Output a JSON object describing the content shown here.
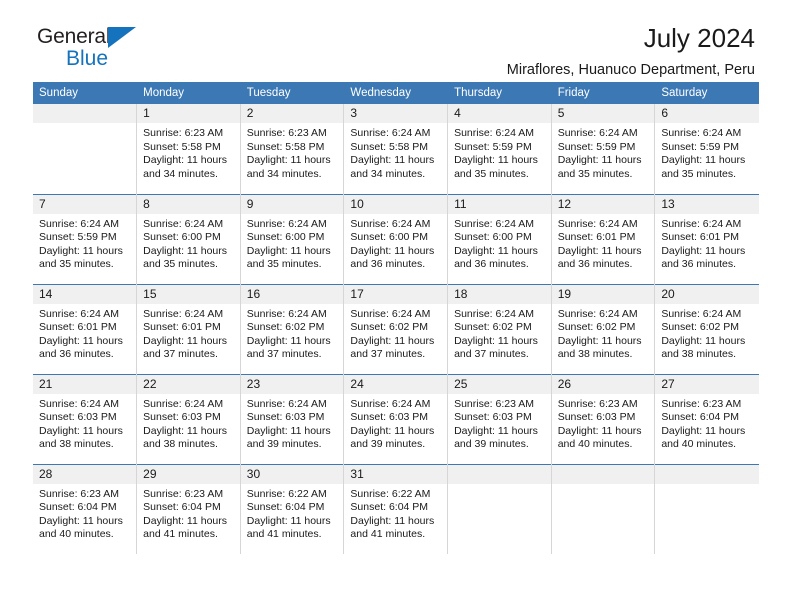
{
  "brand": {
    "name_top": "General",
    "name_bottom": "Blue",
    "triangle_icon": "triangle-icon",
    "color_dark": "#231f20",
    "color_blue": "#1573bd"
  },
  "header": {
    "title": "July 2024",
    "subtitle": "Miraflores, Huanuco Department, Peru"
  },
  "theme": {
    "header_row_bg": "#3c78b4",
    "daynum_bg": "#f0f0f0",
    "text": "#1a1a1a"
  },
  "weekday_headers": [
    "Sunday",
    "Monday",
    "Tuesday",
    "Wednesday",
    "Thursday",
    "Friday",
    "Saturday"
  ],
  "labels": {
    "sunrise_prefix": "Sunrise:",
    "sunset_prefix": "Sunset:",
    "daylight_prefix": "Daylight:"
  },
  "weeks": [
    [
      {
        "day": "",
        "sunrise": "",
        "sunset": "",
        "daylight": ""
      },
      {
        "day": "1",
        "sunrise": "Sunrise: 6:23 AM",
        "sunset": "Sunset: 5:58 PM",
        "daylight": "Daylight: 11 hours and 34 minutes."
      },
      {
        "day": "2",
        "sunrise": "Sunrise: 6:23 AM",
        "sunset": "Sunset: 5:58 PM",
        "daylight": "Daylight: 11 hours and 34 minutes."
      },
      {
        "day": "3",
        "sunrise": "Sunrise: 6:24 AM",
        "sunset": "Sunset: 5:58 PM",
        "daylight": "Daylight: 11 hours and 34 minutes."
      },
      {
        "day": "4",
        "sunrise": "Sunrise: 6:24 AM",
        "sunset": "Sunset: 5:59 PM",
        "daylight": "Daylight: 11 hours and 35 minutes."
      },
      {
        "day": "5",
        "sunrise": "Sunrise: 6:24 AM",
        "sunset": "Sunset: 5:59 PM",
        "daylight": "Daylight: 11 hours and 35 minutes."
      },
      {
        "day": "6",
        "sunrise": "Sunrise: 6:24 AM",
        "sunset": "Sunset: 5:59 PM",
        "daylight": "Daylight: 11 hours and 35 minutes."
      }
    ],
    [
      {
        "day": "7",
        "sunrise": "Sunrise: 6:24 AM",
        "sunset": "Sunset: 5:59 PM",
        "daylight": "Daylight: 11 hours and 35 minutes."
      },
      {
        "day": "8",
        "sunrise": "Sunrise: 6:24 AM",
        "sunset": "Sunset: 6:00 PM",
        "daylight": "Daylight: 11 hours and 35 minutes."
      },
      {
        "day": "9",
        "sunrise": "Sunrise: 6:24 AM",
        "sunset": "Sunset: 6:00 PM",
        "daylight": "Daylight: 11 hours and 35 minutes."
      },
      {
        "day": "10",
        "sunrise": "Sunrise: 6:24 AM",
        "sunset": "Sunset: 6:00 PM",
        "daylight": "Daylight: 11 hours and 36 minutes."
      },
      {
        "day": "11",
        "sunrise": "Sunrise: 6:24 AM",
        "sunset": "Sunset: 6:00 PM",
        "daylight": "Daylight: 11 hours and 36 minutes."
      },
      {
        "day": "12",
        "sunrise": "Sunrise: 6:24 AM",
        "sunset": "Sunset: 6:01 PM",
        "daylight": "Daylight: 11 hours and 36 minutes."
      },
      {
        "day": "13",
        "sunrise": "Sunrise: 6:24 AM",
        "sunset": "Sunset: 6:01 PM",
        "daylight": "Daylight: 11 hours and 36 minutes."
      }
    ],
    [
      {
        "day": "14",
        "sunrise": "Sunrise: 6:24 AM",
        "sunset": "Sunset: 6:01 PM",
        "daylight": "Daylight: 11 hours and 36 minutes."
      },
      {
        "day": "15",
        "sunrise": "Sunrise: 6:24 AM",
        "sunset": "Sunset: 6:01 PM",
        "daylight": "Daylight: 11 hours and 37 minutes."
      },
      {
        "day": "16",
        "sunrise": "Sunrise: 6:24 AM",
        "sunset": "Sunset: 6:02 PM",
        "daylight": "Daylight: 11 hours and 37 minutes."
      },
      {
        "day": "17",
        "sunrise": "Sunrise: 6:24 AM",
        "sunset": "Sunset: 6:02 PM",
        "daylight": "Daylight: 11 hours and 37 minutes."
      },
      {
        "day": "18",
        "sunrise": "Sunrise: 6:24 AM",
        "sunset": "Sunset: 6:02 PM",
        "daylight": "Daylight: 11 hours and 37 minutes."
      },
      {
        "day": "19",
        "sunrise": "Sunrise: 6:24 AM",
        "sunset": "Sunset: 6:02 PM",
        "daylight": "Daylight: 11 hours and 38 minutes."
      },
      {
        "day": "20",
        "sunrise": "Sunrise: 6:24 AM",
        "sunset": "Sunset: 6:02 PM",
        "daylight": "Daylight: 11 hours and 38 minutes."
      }
    ],
    [
      {
        "day": "21",
        "sunrise": "Sunrise: 6:24 AM",
        "sunset": "Sunset: 6:03 PM",
        "daylight": "Daylight: 11 hours and 38 minutes."
      },
      {
        "day": "22",
        "sunrise": "Sunrise: 6:24 AM",
        "sunset": "Sunset: 6:03 PM",
        "daylight": "Daylight: 11 hours and 38 minutes."
      },
      {
        "day": "23",
        "sunrise": "Sunrise: 6:24 AM",
        "sunset": "Sunset: 6:03 PM",
        "daylight": "Daylight: 11 hours and 39 minutes."
      },
      {
        "day": "24",
        "sunrise": "Sunrise: 6:24 AM",
        "sunset": "Sunset: 6:03 PM",
        "daylight": "Daylight: 11 hours and 39 minutes."
      },
      {
        "day": "25",
        "sunrise": "Sunrise: 6:23 AM",
        "sunset": "Sunset: 6:03 PM",
        "daylight": "Daylight: 11 hours and 39 minutes."
      },
      {
        "day": "26",
        "sunrise": "Sunrise: 6:23 AM",
        "sunset": "Sunset: 6:03 PM",
        "daylight": "Daylight: 11 hours and 40 minutes."
      },
      {
        "day": "27",
        "sunrise": "Sunrise: 6:23 AM",
        "sunset": "Sunset: 6:04 PM",
        "daylight": "Daylight: 11 hours and 40 minutes."
      }
    ],
    [
      {
        "day": "28",
        "sunrise": "Sunrise: 6:23 AM",
        "sunset": "Sunset: 6:04 PM",
        "daylight": "Daylight: 11 hours and 40 minutes."
      },
      {
        "day": "29",
        "sunrise": "Sunrise: 6:23 AM",
        "sunset": "Sunset: 6:04 PM",
        "daylight": "Daylight: 11 hours and 41 minutes."
      },
      {
        "day": "30",
        "sunrise": "Sunrise: 6:22 AM",
        "sunset": "Sunset: 6:04 PM",
        "daylight": "Daylight: 11 hours and 41 minutes."
      },
      {
        "day": "31",
        "sunrise": "Sunrise: 6:22 AM",
        "sunset": "Sunset: 6:04 PM",
        "daylight": "Daylight: 11 hours and 41 minutes."
      },
      {
        "day": "",
        "sunrise": "",
        "sunset": "",
        "daylight": ""
      },
      {
        "day": "",
        "sunrise": "",
        "sunset": "",
        "daylight": ""
      },
      {
        "day": "",
        "sunrise": "",
        "sunset": "",
        "daylight": ""
      }
    ]
  ]
}
